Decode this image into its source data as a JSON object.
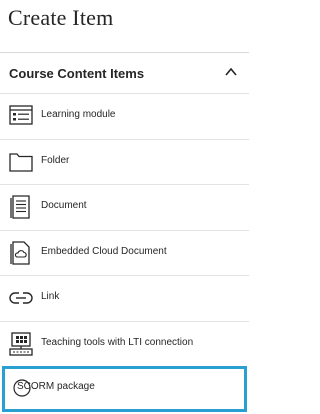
{
  "panel": {
    "title": "Create Item"
  },
  "section": {
    "title": "Course Content Items",
    "expanded": true,
    "toggle_icon": "chevron-up-icon"
  },
  "items": [
    {
      "label": "Learning module",
      "icon": "learning-module-icon"
    },
    {
      "label": "Folder",
      "icon": "folder-icon"
    },
    {
      "label": "Document",
      "icon": "document-icon"
    },
    {
      "label": "Embedded Cloud Document",
      "icon": "cloud-document-icon"
    },
    {
      "label": "Link",
      "icon": "link-icon"
    },
    {
      "label": "Teaching tools with LTI connection",
      "icon": "lti-tool-icon"
    },
    {
      "label": "SCORM package",
      "icon": "scorm-package-icon",
      "selected": true
    }
  ],
  "colors": {
    "selection_border": "#2a9fd1",
    "text": "#262626",
    "divider": "#e3e3e3"
  }
}
